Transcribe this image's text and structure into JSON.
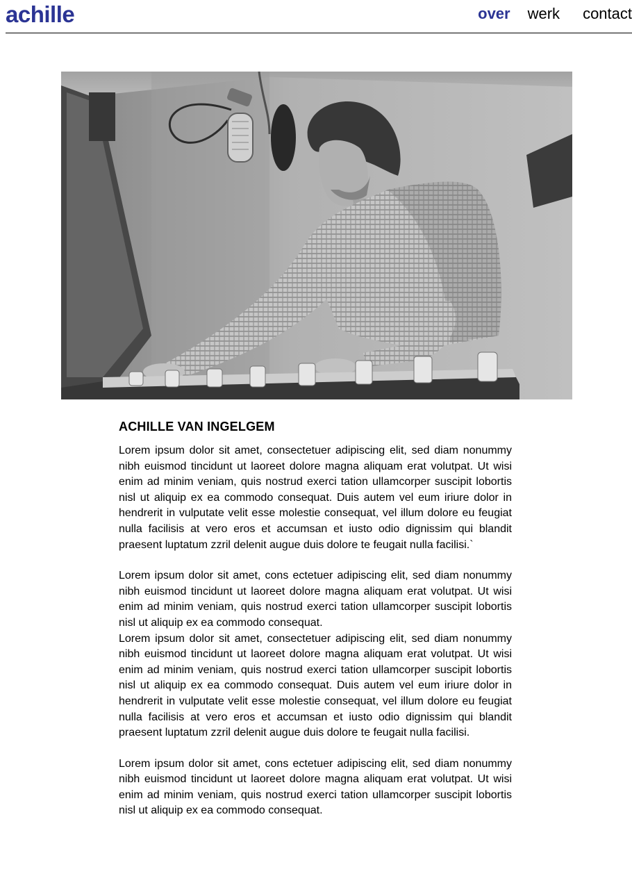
{
  "header": {
    "logo": "achille",
    "nav": [
      {
        "label": "over",
        "active": true
      },
      {
        "label": "werk",
        "active": false
      },
      {
        "label": "contact",
        "active": false
      }
    ],
    "accent_color": "#2b3494"
  },
  "hero": {
    "icon": "portrait-photo",
    "description_visible": false
  },
  "about": {
    "name": "ACHILLE VAN INGELGEM",
    "paragraphs": [
      "Lorem ipsum dolor sit amet, consectetuer adipiscing elit, sed diam nonummy nibh euismod tincidunt ut laoreet dolore magna aliquam erat volutpat. Ut wisi enim ad minim veniam, quis nostrud exerci tation ullamcorper suscipit lobortis nisl ut aliquip ex ea commodo consequat. Duis autem vel eum iriure dolor in hendrerit in vulputate velit esse molestie consequat, vel illum dolore eu feugiat nulla facilisis at vero eros et accumsan et iusto odio dignissim qui blandit praesent luptatum zzril delenit augue duis dolore te feugait nulla facilisi.`",
      "Lorem ipsum dolor sit amet, cons ectetuer adipiscing elit, sed diam nonummy nibh euismod tincidunt ut laoreet dolore magna aliquam erat volutpat. Ut wisi enim ad minim veniam, quis nostrud exerci tation ullamcorper suscipit lobortis nisl ut aliquip ex ea commodo consequat.",
      "Lorem ipsum dolor sit amet, consectetuer adipiscing elit, sed diam nonummy nibh euismod tincidunt ut laoreet dolore magna aliquam erat volutpat. Ut wisi enim ad minim veniam, quis nostrud exerci tation ullamcorper suscipit lobortis nisl ut aliquip ex ea commodo consequat. Duis autem vel eum iriure dolor in hendrerit in vulputate velit esse molestie consequat, vel illum dolore eu feugiat nulla facilisis at vero eros et accumsan et iusto odio dignissim qui blandit praesent luptatum zzril delenit augue duis dolore te feugait nulla facilisi.",
      "Lorem ipsum dolor sit amet, cons ectetuer adipiscing elit, sed diam nonummy nibh euismod tincidunt ut laoreet dolore magna aliquam erat volutpat. Ut wisi enim ad minim veniam, quis nostrud exerci tation ullamcorper suscipit lobortis nisl ut aliquip ex ea commodo consequat."
    ]
  }
}
